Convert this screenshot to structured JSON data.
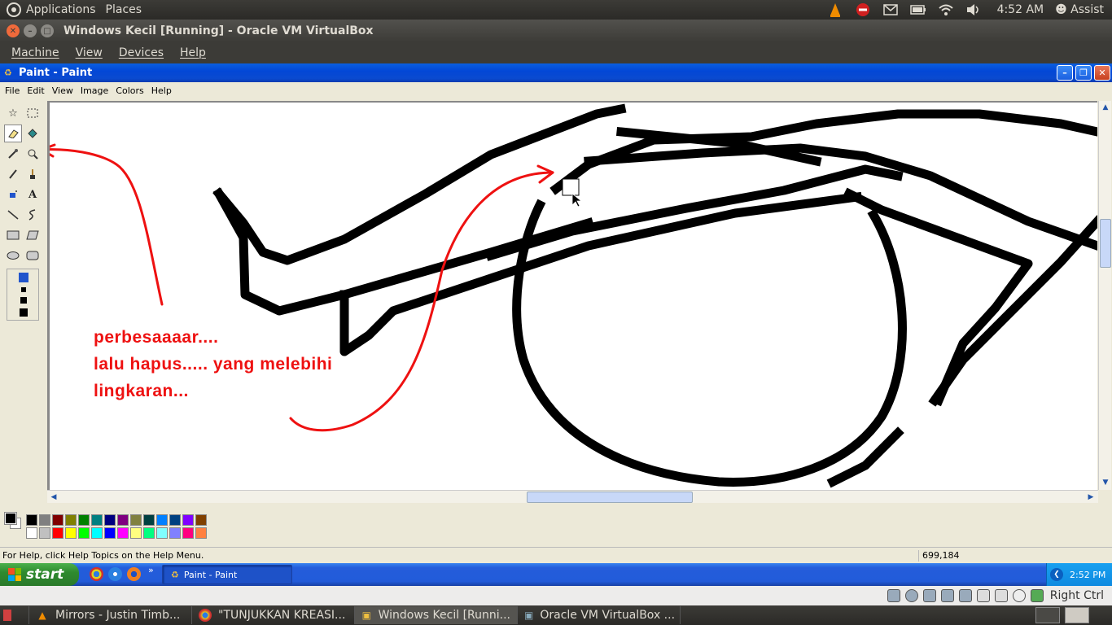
{
  "top_panel": {
    "applications": "Applications",
    "places": "Places",
    "clock": "4:52 AM",
    "user": "Assist",
    "tray_icons": [
      "vlc-icon",
      "stop-icon",
      "mail-icon",
      "battery-icon",
      "wifi-icon",
      "volume-icon"
    ]
  },
  "vbox": {
    "title": "Windows Kecil [Running] - Oracle VM VirtualBox",
    "menu": [
      "Machine",
      "View",
      "Devices",
      "Help"
    ],
    "host_key": "Right Ctrl"
  },
  "paint": {
    "title": "Paint - Paint",
    "menu": [
      "File",
      "Edit",
      "View",
      "Image",
      "Colors",
      "Help"
    ],
    "status_help": "For Help, click Help Topics on the Help Menu.",
    "status_coords": "699,184",
    "selected_tool": "eraser",
    "palette_top": [
      "#000000",
      "#808080",
      "#800000",
      "#808000",
      "#008000",
      "#008080",
      "#000080",
      "#800080",
      "#808040",
      "#004040",
      "#0080ff",
      "#004080",
      "#8000ff",
      "#804000"
    ],
    "palette_bottom": [
      "#ffffff",
      "#c0c0c0",
      "#ff0000",
      "#ffff00",
      "#00ff00",
      "#00ffff",
      "#0000ff",
      "#ff00ff",
      "#ffff80",
      "#00ff80",
      "#80ffff",
      "#8080ff",
      "#ff0080",
      "#ff8040"
    ],
    "annotation": {
      "line1": "perbesaaaar....",
      "line2": "lalu hapus..... yang melebihi",
      "line3": "lingkaran..."
    }
  },
  "xp_taskbar": {
    "start": "start",
    "task_paint": "Paint - Paint",
    "clock": "2:52 PM"
  },
  "bottom_panel": {
    "items": [
      {
        "icon": "vlc-icon",
        "label": "Mirrors - Justin Timb..."
      },
      {
        "icon": "chrome-icon",
        "label": "\"TUNJUKKAN KREASI..."
      },
      {
        "icon": "virtualbox-icon",
        "label": "Windows Kecil [Runni..."
      },
      {
        "icon": "virtualbox-icon",
        "label": "Oracle VM VirtualBox ..."
      }
    ]
  }
}
